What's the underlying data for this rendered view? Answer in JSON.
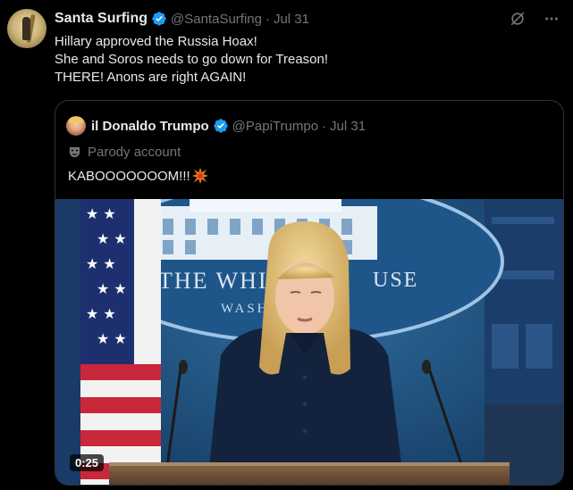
{
  "post": {
    "author_name": "Santa Surfing",
    "author_handle": "@SantaSurfing",
    "separator": "·",
    "date": "Jul 31",
    "text_lines": [
      "Hillary approved the Russia Hoax!",
      "She and Soros needs to go down for Treason!",
      "THERE! Anons are right AGAIN!"
    ]
  },
  "quoted": {
    "author_name": "il Donaldo Trumpo",
    "author_handle": "@PapiTrumpo",
    "separator": "·",
    "date": "Jul 31",
    "label": "Parody account",
    "text": "KABOOOOOOOM!!!",
    "video": {
      "sign_text_left": "THE WHIT",
      "sign_text_right": "USE",
      "sign_text_sub": "WASH",
      "timestamp": "0:25"
    }
  },
  "icons": {
    "verified": "verified-badge-icon",
    "grok": "grok-icon",
    "more": "more-icon",
    "parody": "parody-mask-icon",
    "boom": "collision-emoji-icon"
  },
  "colors": {
    "background": "#000000",
    "text": "#e7e9ea",
    "muted": "#71767b",
    "verified": "#1d9bf0",
    "border": "#2f3336"
  }
}
